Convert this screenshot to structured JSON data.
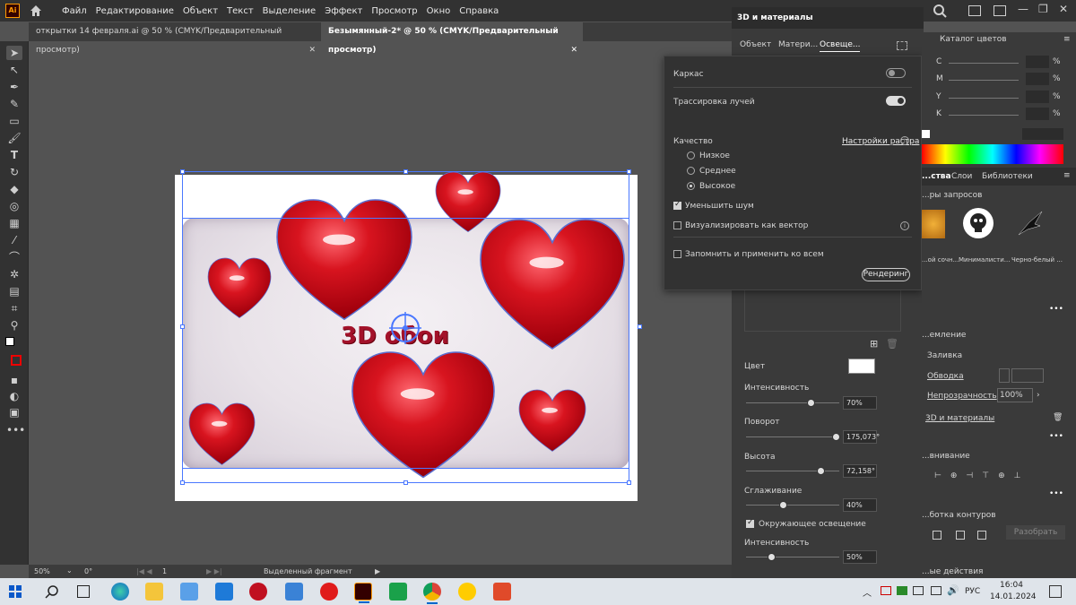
{
  "app": {
    "logo": "Ai",
    "home_icon": "home-icon"
  },
  "menu": [
    "Файл",
    "Редактирование",
    "Объект",
    "Текст",
    "Выделение",
    "Эффект",
    "Просмотр",
    "Окно",
    "Справка"
  ],
  "window_controls": [
    "—",
    "❐",
    "✕"
  ],
  "tabs": [
    {
      "label": "открытки 14 февраля.ai @ 50 % (CMYK/Предварительный просмотр)",
      "active": false
    },
    {
      "label": "Безымянный-2* @ 50 % (CMYK/Предварительный просмотр)",
      "active": true
    }
  ],
  "artwork": {
    "text": "3D обои"
  },
  "status": {
    "zoom": "50%",
    "rotation": "0°",
    "artboard": "1",
    "selection": "Выделенный фрагмент"
  },
  "panel3d": {
    "title": "3D и материалы",
    "tabs": [
      "Объект",
      "Матери...",
      "Освеще..."
    ],
    "light": {
      "color_label": "Цвет",
      "intensity_label": "Интенсивность",
      "intensity": "70%",
      "intensity_frac": 0.7,
      "rotation_label": "Поворот",
      "rotation": "175,073°",
      "rotation_frac": 0.97,
      "height_label": "Высота",
      "height": "72,158°",
      "height_frac": 0.81,
      "smoothing_label": "Сглаживание",
      "smoothing": "40%",
      "smoothing_frac": 0.4,
      "ambient_label": "Окружающее освещение",
      "ambient_intensity_label": "Интенсивность",
      "ambient_intensity": "50%",
      "ambient_intensity_frac": 0.28
    }
  },
  "render_popup": {
    "wireframe_label": "Каркас",
    "wireframe_on": false,
    "raytrace_label": "Трассировка лучей",
    "raytrace_on": true,
    "quality_label": "Качество",
    "raster_settings_link": "Настройки растра",
    "quality_options": [
      {
        "label": "Низкое",
        "selected": false
      },
      {
        "label": "Среднее",
        "selected": false
      },
      {
        "label": "Высокое",
        "selected": true
      }
    ],
    "reduce_noise_label": "Уменьшить шум",
    "reduce_noise_checked": true,
    "vector_label": "Визуализировать как вектор",
    "vector_checked": false,
    "remember_label": "Запомнить и применить ко всем",
    "remember_checked": false,
    "render_button": "Рендеринг"
  },
  "right_panel": {
    "color_catalog_tab": "Каталог цветов",
    "cmyk": [
      {
        "ch": "C",
        "unit": "%"
      },
      {
        "ch": "M",
        "unit": "%"
      },
      {
        "ch": "Y",
        "unit": "%"
      },
      {
        "ch": "K",
        "unit": "%"
      }
    ],
    "tabs": [
      "...ства",
      "Слои",
      "Библиотеки"
    ],
    "suggestions_title": "...ры запросов",
    "suggestions": [
      "...ой сочн...",
      "Минималисти...",
      "Черно-белый ..."
    ],
    "appearance_title": "...емление",
    "fill_label": "Заливка",
    "stroke_label": "Обводка",
    "opacity_label": "Непрозрачность",
    "opacity": "100%",
    "effect_label": "3D и материалы",
    "align_title": "...внивание",
    "pathfinder_title": "...ботка контуров",
    "expand_button": "Разобрать",
    "quick_actions_title": "...ые действия"
  },
  "taskbar": {
    "lang": "РУС",
    "time": "16:04",
    "date": "14.01.2024"
  },
  "colors": {
    "heart": "#c4101e",
    "accent": "#4a78ff",
    "app_orange": "#ff9a00"
  }
}
